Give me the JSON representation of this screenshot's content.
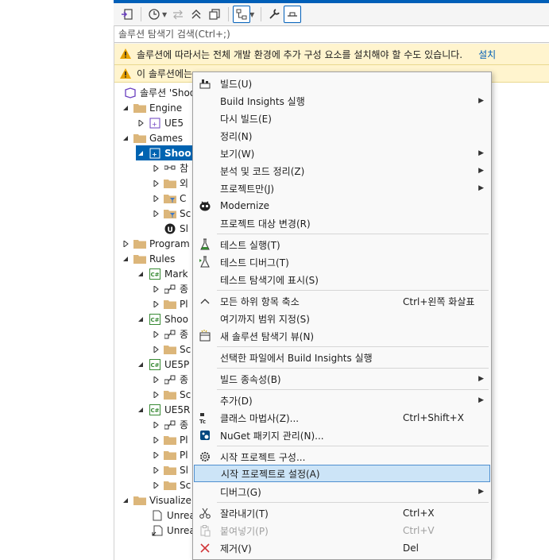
{
  "search": {
    "placeholder": "솔루션 탐색기 검색(Ctrl+;)"
  },
  "banners": [
    {
      "text": "솔루션에 따라서는 전체 개발 환경에 추가 구성 요소를 설치해야 할 수도 있습니다.",
      "link": "설치"
    },
    {
      "text": "이 솔루션에는",
      "link": ""
    }
  ],
  "tree": {
    "solution": "솔루션 'Shoo",
    "engine": "Engine",
    "ue5": "UE5",
    "games": "Games",
    "shoo_selected": "Shoo",
    "child1": "참",
    "child2": "외",
    "child3": "C",
    "child4": "Sc",
    "child5": "Sl",
    "programs": "Program",
    "rules": "Rules",
    "mark": "Mark",
    "mark_c1": "종",
    "mark_c2": "Pl",
    "shoo2": "Shoo",
    "shoo2_c1": "종",
    "shoo2_c2": "Sc",
    "ue5p": "UE5P",
    "ue5p_c1": "종",
    "ue5p_c2": "Sc",
    "ue5r": "UE5R",
    "ue5r_c1": "종",
    "ue5r_c2": "Pl",
    "ue5r_c3": "Pl",
    "ue5r_c4": "Sl",
    "ue5r_c5": "Sc",
    "visualizers": "Visualize",
    "unreal1": "Unrea",
    "unreal2": "Unrea"
  },
  "menu": {
    "build": "빌드(U)",
    "build_insights": "Build Insights 실행",
    "rebuild": "다시 빌드(E)",
    "clean": "정리(N)",
    "view": "보기(W)",
    "analyze": "분석 및 코드 정리(Z)",
    "project_only": "프로젝트만(J)",
    "modernize": "Modernize",
    "retarget": "프로젝트 대상 변경(R)",
    "run_tests": "테스트 실행(T)",
    "debug_tests": "테스트 디버그(T)",
    "show_test_explorer": "테스트 탐색기에 표시(S)",
    "collapse_all": "모든 하위 항목 축소",
    "collapse_all_shortcut": "Ctrl+왼쪽 화살표",
    "scope_to_this": "여기까지 범위 지정(S)",
    "new_view": "새 솔루션 탐색기 뷰(N)",
    "build_insights_selected": "선택한 파일에서 Build Insights 실행",
    "build_dependencies": "빌드 종속성(B)",
    "add": "추가(D)",
    "class_wizard": "클래스 마법사(Z)...",
    "class_wizard_shortcut": "Ctrl+Shift+X",
    "nuget": "NuGet 패키지 관리(N)...",
    "configure_startup": "시작 프로젝트 구성...",
    "set_startup": "시작 프로젝트로 설정(A)",
    "debug": "디버그(G)",
    "cut": "잘라내기(T)",
    "cut_shortcut": "Ctrl+X",
    "paste": "붙여넣기(P)",
    "paste_shortcut": "Ctrl+V",
    "remove": "제거(V)",
    "remove_shortcut": "Del"
  },
  "colors": {
    "accent": "#005fb8",
    "selection": "#0063b1",
    "warning": "#fff4ce",
    "hover": "#cce4f7"
  }
}
